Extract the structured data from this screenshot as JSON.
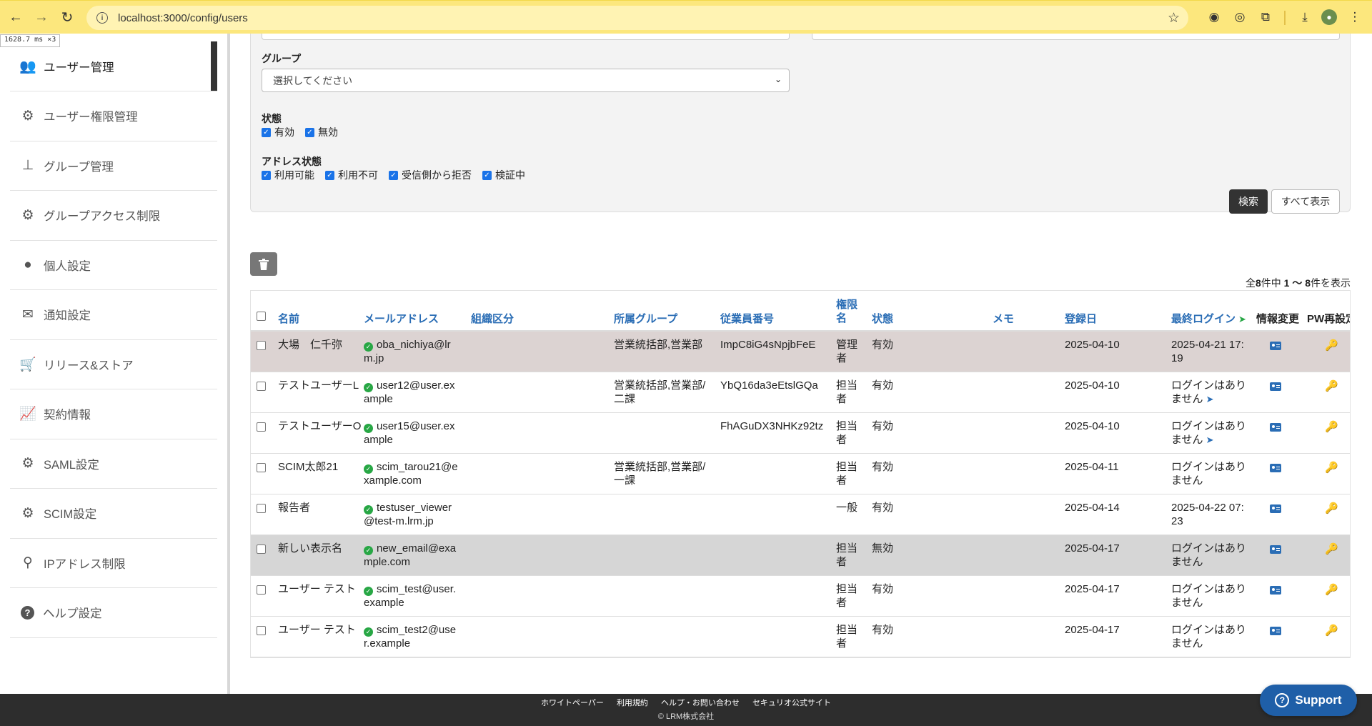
{
  "browser": {
    "url": "localhost:3000/config/users",
    "timing": "1628.7 ms  ×3"
  },
  "sidebar": {
    "items": [
      {
        "label": "ユーザー管理",
        "icon": "users-icon"
      },
      {
        "label": "ユーザー権限管理",
        "icon": "gear-icon"
      },
      {
        "label": "グループ管理",
        "icon": "sitemap-icon"
      },
      {
        "label": "グループアクセス制限",
        "icon": "gear-icon"
      },
      {
        "label": "個人設定",
        "icon": "user-icon"
      },
      {
        "label": "通知設定",
        "icon": "envelope-icon"
      },
      {
        "label": "リリース&ストア",
        "icon": "cart-icon"
      },
      {
        "label": "契約情報",
        "icon": "chart-icon"
      },
      {
        "label": "SAML設定",
        "icon": "gears-icon"
      },
      {
        "label": "SCIM設定",
        "icon": "users-gear-icon"
      },
      {
        "label": "IPアドレス制限",
        "icon": "map-pin-icon"
      },
      {
        "label": "ヘルプ設定",
        "icon": "question-icon"
      }
    ]
  },
  "search": {
    "group_label": "グループ",
    "group_select": "選択してください",
    "status_label": "状態",
    "status_options": [
      "有効",
      "無効"
    ],
    "address_label": "アドレス状態",
    "address_options": [
      "利用可能",
      "利用不可",
      "受信側から拒否",
      "検証中"
    ],
    "search_button": "検索",
    "show_all_button": "すべて表示"
  },
  "count": {
    "prefix": "全",
    "total": "8",
    "mid": "件中",
    "range": "1 〜 8",
    "suffix": "件を表示"
  },
  "table": {
    "headers": {
      "name": "名前",
      "email": "メールアドレス",
      "org": "組織区分",
      "group": "所属グループ",
      "emp": "従業員番号",
      "role": "権限名",
      "status": "状態",
      "memo": "メモ",
      "registered": "登録日",
      "last_login": "最終ログイン",
      "edit": "情報変更",
      "pw": "PW再設定"
    },
    "rows": [
      {
        "name": "大場　仁千弥",
        "email": "oba_nichiya@lrm.jp",
        "group": "営業統括部,営業部",
        "emp": "ImpC8iG4sNpjbFeE",
        "role": "管理者",
        "status": "有効",
        "registered": "2025-04-10",
        "last_login": "2025-04-21 17:19",
        "plane": false
      },
      {
        "name": "テストユーザーL",
        "email": "user12@user.example",
        "group": "営業統括部,営業部/二課",
        "emp": "YbQ16da3eEtslGQa",
        "role": "担当者",
        "status": "有効",
        "registered": "2025-04-10",
        "last_login": "ログインはありません",
        "plane": true
      },
      {
        "name": "テストユーザーO",
        "email": "user15@user.example",
        "group": "",
        "emp": "FhAGuDX3NHKz92tz",
        "role": "担当者",
        "status": "有効",
        "registered": "2025-04-10",
        "last_login": "ログインはありません",
        "plane": true
      },
      {
        "name": "SCIM太郎21",
        "email": "scim_tarou21@example.com",
        "group": "営業統括部,営業部/一課",
        "emp": "",
        "role": "担当者",
        "status": "有効",
        "registered": "2025-04-11",
        "last_login": "ログインはありません",
        "plane": false
      },
      {
        "name": "報告者",
        "email": "testuser_viewer@test-m.lrm.jp",
        "group": "",
        "emp": "",
        "role": "一般",
        "status": "有効",
        "registered": "2025-04-14",
        "last_login": "2025-04-22 07:23",
        "plane": false
      },
      {
        "name": "新しい表示名",
        "email": "new_email@example.com",
        "group": "",
        "emp": "",
        "role": "担当者",
        "status": "無効",
        "registered": "2025-04-17",
        "last_login": "ログインはありません",
        "plane": false
      },
      {
        "name": "ユーザー テスト",
        "email": "scim_test@user.example",
        "group": "",
        "emp": "",
        "role": "担当者",
        "status": "有効",
        "registered": "2025-04-17",
        "last_login": "ログインはありません",
        "plane": false
      },
      {
        "name": "ユーザー テスト",
        "email": "scim_test2@user.example",
        "group": "",
        "emp": "",
        "role": "担当者",
        "status": "有効",
        "registered": "2025-04-17",
        "last_login": "ログインはありません",
        "plane": false
      }
    ]
  },
  "footer": {
    "links": [
      "ホワイトペーパー",
      "利用規約",
      "ヘルプ・お問い合わせ",
      "セキュリオ公式サイト"
    ],
    "copyright": "© LRM株式会社"
  },
  "support": {
    "label": "Support"
  }
}
